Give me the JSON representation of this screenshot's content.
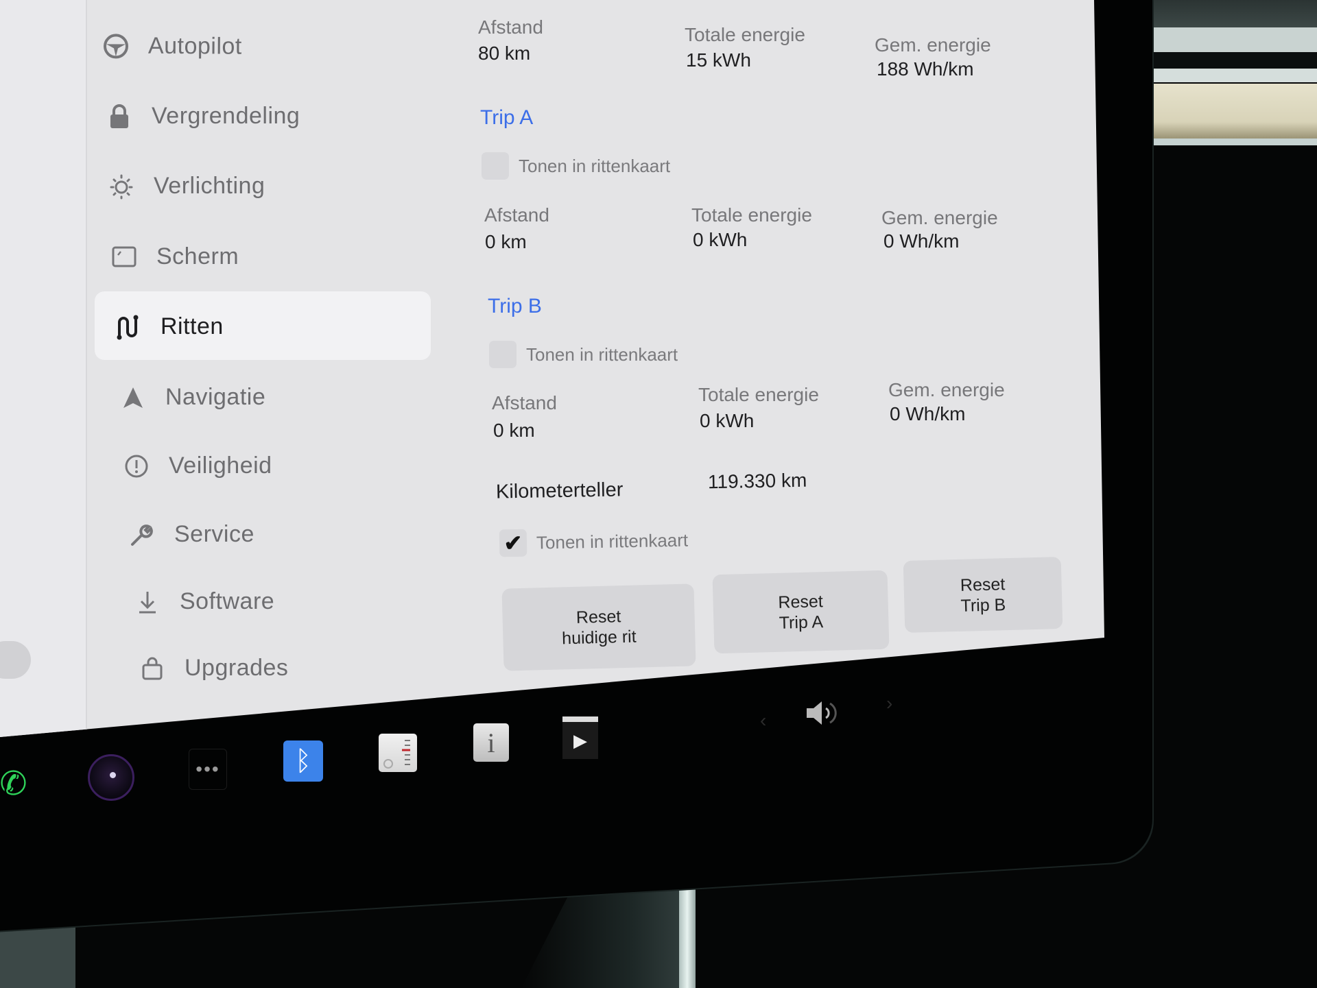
{
  "sidebar": {
    "items": [
      {
        "label": "Autopilot",
        "icon": "steering-wheel-icon",
        "active": false
      },
      {
        "label": "Vergrendeling",
        "icon": "lock-icon",
        "active": false
      },
      {
        "label": "Verlichting",
        "icon": "light-bulb-icon",
        "active": false
      },
      {
        "label": "Scherm",
        "icon": "display-icon",
        "active": false
      },
      {
        "label": "Ritten",
        "icon": "trips-icon",
        "active": true
      },
      {
        "label": "Navigatie",
        "icon": "navigation-arrow-icon",
        "active": false
      },
      {
        "label": "Veiligheid",
        "icon": "alert-circle-icon",
        "active": false
      },
      {
        "label": "Service",
        "icon": "wrench-icon",
        "active": false
      },
      {
        "label": "Software",
        "icon": "download-icon",
        "active": false
      },
      {
        "label": "Upgrades",
        "icon": "shopping-bag-icon",
        "active": false
      }
    ]
  },
  "current_trip": {
    "distance_label": "Afstand",
    "distance_value": "80 km",
    "energy_label": "Totale energie",
    "energy_value": "15 kWh",
    "avg_label": "Gem. energie",
    "avg_value": "188 Wh/km"
  },
  "trip_a": {
    "title": "Trip A",
    "show_on_map_label": "Tonen in rittenkaart",
    "show_on_map_checked": false,
    "distance_label": "Afstand",
    "distance_value": "0 km",
    "energy_label": "Totale energie",
    "energy_value": "0 kWh",
    "avg_label": "Gem. energie",
    "avg_value": "0 Wh/km"
  },
  "trip_b": {
    "title": "Trip B",
    "show_on_map_label": "Tonen in rittenkaart",
    "show_on_map_checked": false,
    "distance_label": "Afstand",
    "distance_value": "0 km",
    "energy_label": "Totale energie",
    "energy_value": "0 kWh",
    "avg_label": "Gem. energie",
    "avg_value": "0 Wh/km"
  },
  "odometer": {
    "label": "Kilometerteller",
    "value": "119.330 km",
    "show_on_map_label": "Tonen in rittenkaart",
    "show_on_map_checked": true,
    "check_glyph": "✔"
  },
  "buttons": {
    "reset_current_line1": "Reset",
    "reset_current_line2": "huidige rit",
    "reset_a_line1": "Reset",
    "reset_a_line2": "Trip A",
    "reset_b_line1": "Reset",
    "reset_b_line2": "Trip B"
  },
  "dock": {
    "phone_glyph": "✆",
    "dots_glyph": "•••",
    "bluetooth_glyph": "ᛒ",
    "info_glyph": "i",
    "media_glyph": "▶",
    "volume_glyph": "🔈",
    "prev_glyph": "‹",
    "next_glyph": "›"
  },
  "colors": {
    "accent": "#3c6ee8",
    "bluetooth": "#3c83ea",
    "phone": "#2fd45a"
  }
}
